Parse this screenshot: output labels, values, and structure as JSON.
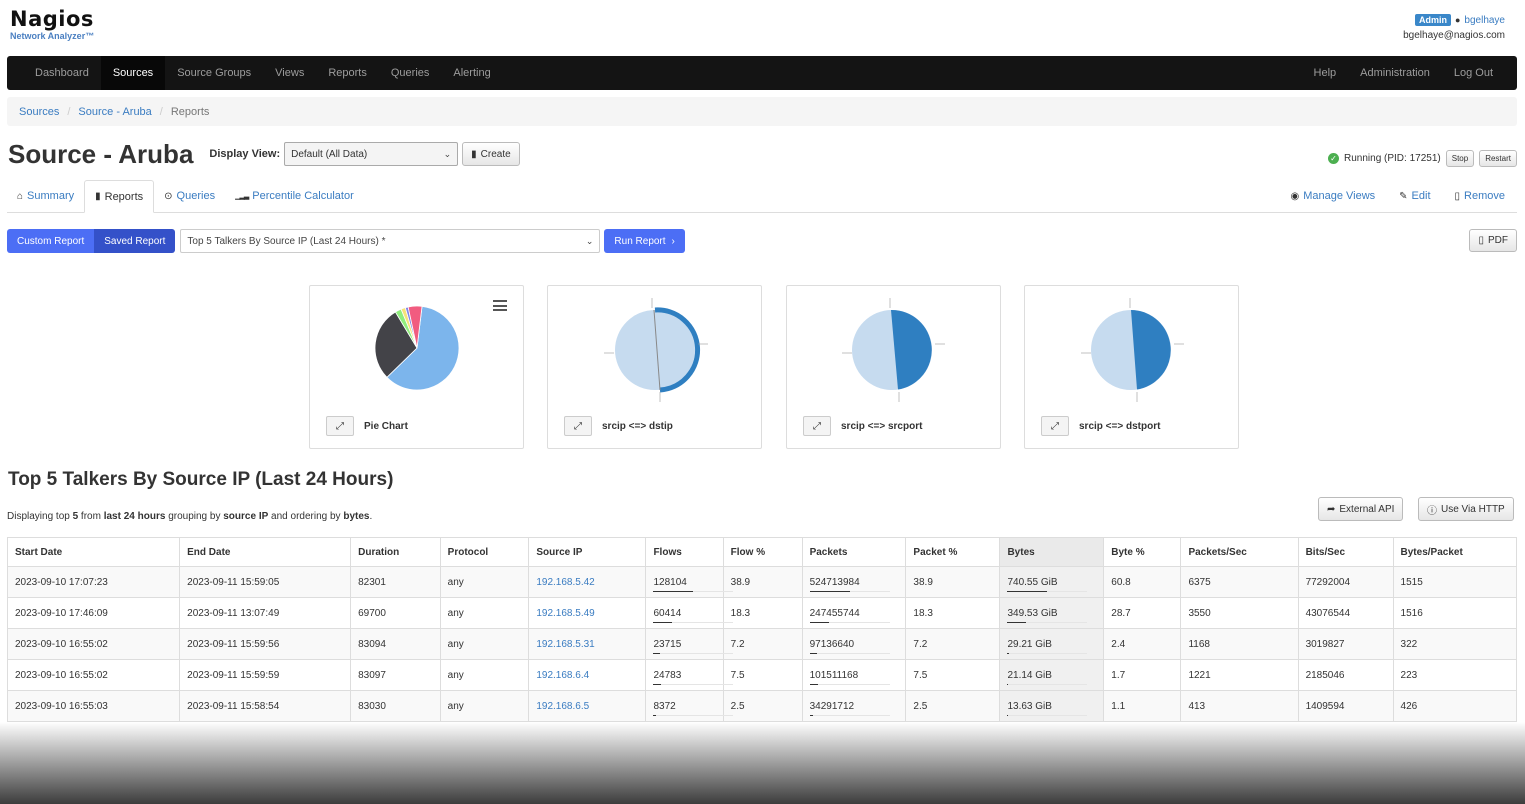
{
  "logo": {
    "main": "Nagios",
    "sub": "Network Analyzer™"
  },
  "user": {
    "badge": "Admin",
    "name": "bgelhaye",
    "email": "bgelhaye@nagios.com"
  },
  "nav": {
    "left": [
      "Dashboard",
      "Sources",
      "Source Groups",
      "Views",
      "Reports",
      "Queries",
      "Alerting"
    ],
    "active": "Sources",
    "right": [
      "Help",
      "Administration",
      "Log Out"
    ]
  },
  "breadcrumb": {
    "items": [
      "Sources",
      "Source - Aruba"
    ],
    "active": "Reports"
  },
  "page": {
    "title": "Source - Aruba",
    "display_view_label": "Display View:",
    "display_view_value": "Default (All Data)",
    "create_label": "Create"
  },
  "status": {
    "text": "Running (PID: 17251)",
    "stop_label": "Stop",
    "restart_label": "Restart"
  },
  "tabs": {
    "left": [
      {
        "label": "Summary",
        "icon": "home-icon",
        "glyph": "⌂"
      },
      {
        "label": "Reports",
        "icon": "document-icon",
        "glyph": "▮"
      },
      {
        "label": "Queries",
        "icon": "target-icon",
        "glyph": "⊙"
      },
      {
        "label": "Percentile Calculator",
        "icon": "bar-chart-icon",
        "glyph": "▁▂▃"
      }
    ],
    "active": "Reports",
    "right": [
      {
        "label": "Manage Views",
        "icon": "eye-icon",
        "glyph": "◉"
      },
      {
        "label": "Edit",
        "icon": "wrench-icon",
        "glyph": "✎"
      },
      {
        "label": "Remove",
        "icon": "trash-icon",
        "glyph": "▯"
      }
    ]
  },
  "report_bar": {
    "custom_label": "Custom Report",
    "saved_label": "Saved Report",
    "selected_report": "Top 5 Talkers By Source IP (Last 24 Hours) *",
    "run_label": "Run Report",
    "pdf_label": "PDF"
  },
  "cards": [
    {
      "title": "Pie Chart"
    },
    {
      "title": "srcip <=> dstip"
    },
    {
      "title": "srcip <=> srcport"
    },
    {
      "title": "srcip <=> dstport"
    }
  ],
  "chart_data": [
    {
      "type": "pie",
      "slices": [
        {
          "value": 60.8,
          "color": "#7cb5ec"
        },
        {
          "value": 28.7,
          "color": "#434348"
        },
        {
          "value": 2.4,
          "color": "#90ed7d"
        },
        {
          "value": 1.7,
          "color": "#f7e37a"
        },
        {
          "value": 1.1,
          "color": "#8085e9"
        },
        {
          "value": 5.3,
          "color": "#f15c80"
        }
      ]
    }
  ],
  "report": {
    "title": "Top 5 Talkers By Source IP (Last 24 Hours)",
    "desc_prefix": "Displaying top ",
    "desc_top": "5",
    "desc_mid1": " from ",
    "desc_range": "last 24 hours",
    "desc_mid2": " grouping by ",
    "desc_group": "source IP",
    "desc_mid3": " and ordering by ",
    "desc_order": "bytes",
    "desc_end": ".",
    "external_api_label": "External API",
    "http_label": "Use Via HTTP"
  },
  "table": {
    "columns": [
      "Start Date",
      "End Date",
      "Duration",
      "Protocol",
      "Source IP",
      "Flows",
      "Flow %",
      "Packets",
      "Packet %",
      "Bytes",
      "Byte %",
      "Packets/Sec",
      "Bits/Sec",
      "Bytes/Packet"
    ],
    "rows": [
      [
        "2023-09-10 17:07:23",
        "2023-09-11 15:59:05",
        "82301",
        "any",
        "192.168.5.42",
        "128104",
        "38.9",
        "524713984",
        "38.9",
        "740.55 GiB",
        "60.8",
        "6375",
        "77292004",
        "1515"
      ],
      [
        "2023-09-10 17:46:09",
        "2023-09-11 13:07:49",
        "69700",
        "any",
        "192.168.5.49",
        "60414",
        "18.3",
        "247455744",
        "18.3",
        "349.53 GiB",
        "28.7",
        "3550",
        "43076544",
        "1516"
      ],
      [
        "2023-09-10 16:55:02",
        "2023-09-11 15:59:56",
        "83094",
        "any",
        "192.168.5.31",
        "23715",
        "7.2",
        "97136640",
        "7.2",
        "29.21 GiB",
        "2.4",
        "1168",
        "3019827",
        "322"
      ],
      [
        "2023-09-10 16:55:02",
        "2023-09-11 15:59:59",
        "83097",
        "any",
        "192.168.6.4",
        "24783",
        "7.5",
        "101511168",
        "7.5",
        "21.14 GiB",
        "1.7",
        "1221",
        "2185046",
        "223"
      ],
      [
        "2023-09-10 16:55:03",
        "2023-09-11 15:58:54",
        "83030",
        "any",
        "192.168.6.5",
        "8372",
        "2.5",
        "34291712",
        "2.5",
        "13.63 GiB",
        "1.1",
        "413",
        "1409594",
        "426"
      ]
    ]
  }
}
